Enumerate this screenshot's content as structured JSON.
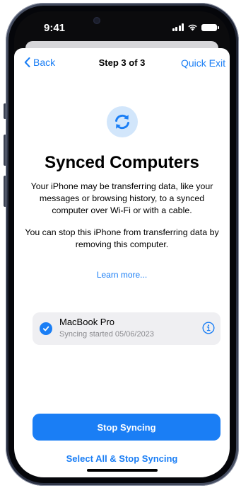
{
  "status_bar": {
    "time": "9:41"
  },
  "nav": {
    "back_label": "Back",
    "title": "Step 3 of 3",
    "quick_exit_label": "Quick Exit"
  },
  "main": {
    "icon": "sync-arrows-icon",
    "heading": "Synced Computers",
    "paragraph_1": "Your iPhone may be transferring data, like your messages or browsing history, to a synced computer over Wi-Fi or with a cable.",
    "paragraph_2": "You can stop this iPhone from transferring data by removing this computer.",
    "learn_more": "Learn more..."
  },
  "device": {
    "name": "MacBook Pro",
    "status": "Syncing started 05/06/2023",
    "selected": true
  },
  "actions": {
    "stop_syncing_label": "Stop Syncing",
    "select_all_label": "Select All & Stop Syncing"
  },
  "colors": {
    "accent": "#1a7ef5",
    "icon_bg": "#d2e6fb",
    "row_bg": "#efeff2",
    "secondary_text": "#8a8a8e"
  }
}
